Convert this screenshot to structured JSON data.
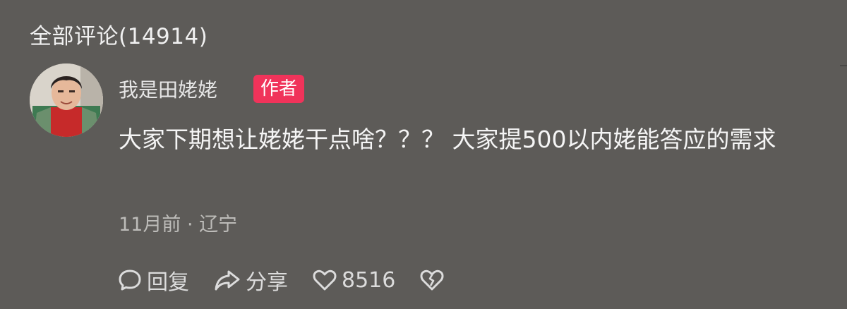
{
  "header": {
    "title": "全部评论(14914)"
  },
  "comment": {
    "username": "我是田姥姥",
    "badge": "作者",
    "text": "大家下期想让姥姥干点啥？？？ 大家提500以内姥能答应的需求",
    "meta": "11月前 · 辽宁",
    "actions": {
      "reply_label": "回复",
      "share_label": "分享",
      "like_count": "8516"
    }
  },
  "icons": {
    "reply": "comment-bubble-icon",
    "share": "share-arrow-icon",
    "like": "heart-icon",
    "dislike": "broken-heart-icon"
  },
  "colors": {
    "background": "#5d5b58",
    "badge": "#f0335a"
  }
}
